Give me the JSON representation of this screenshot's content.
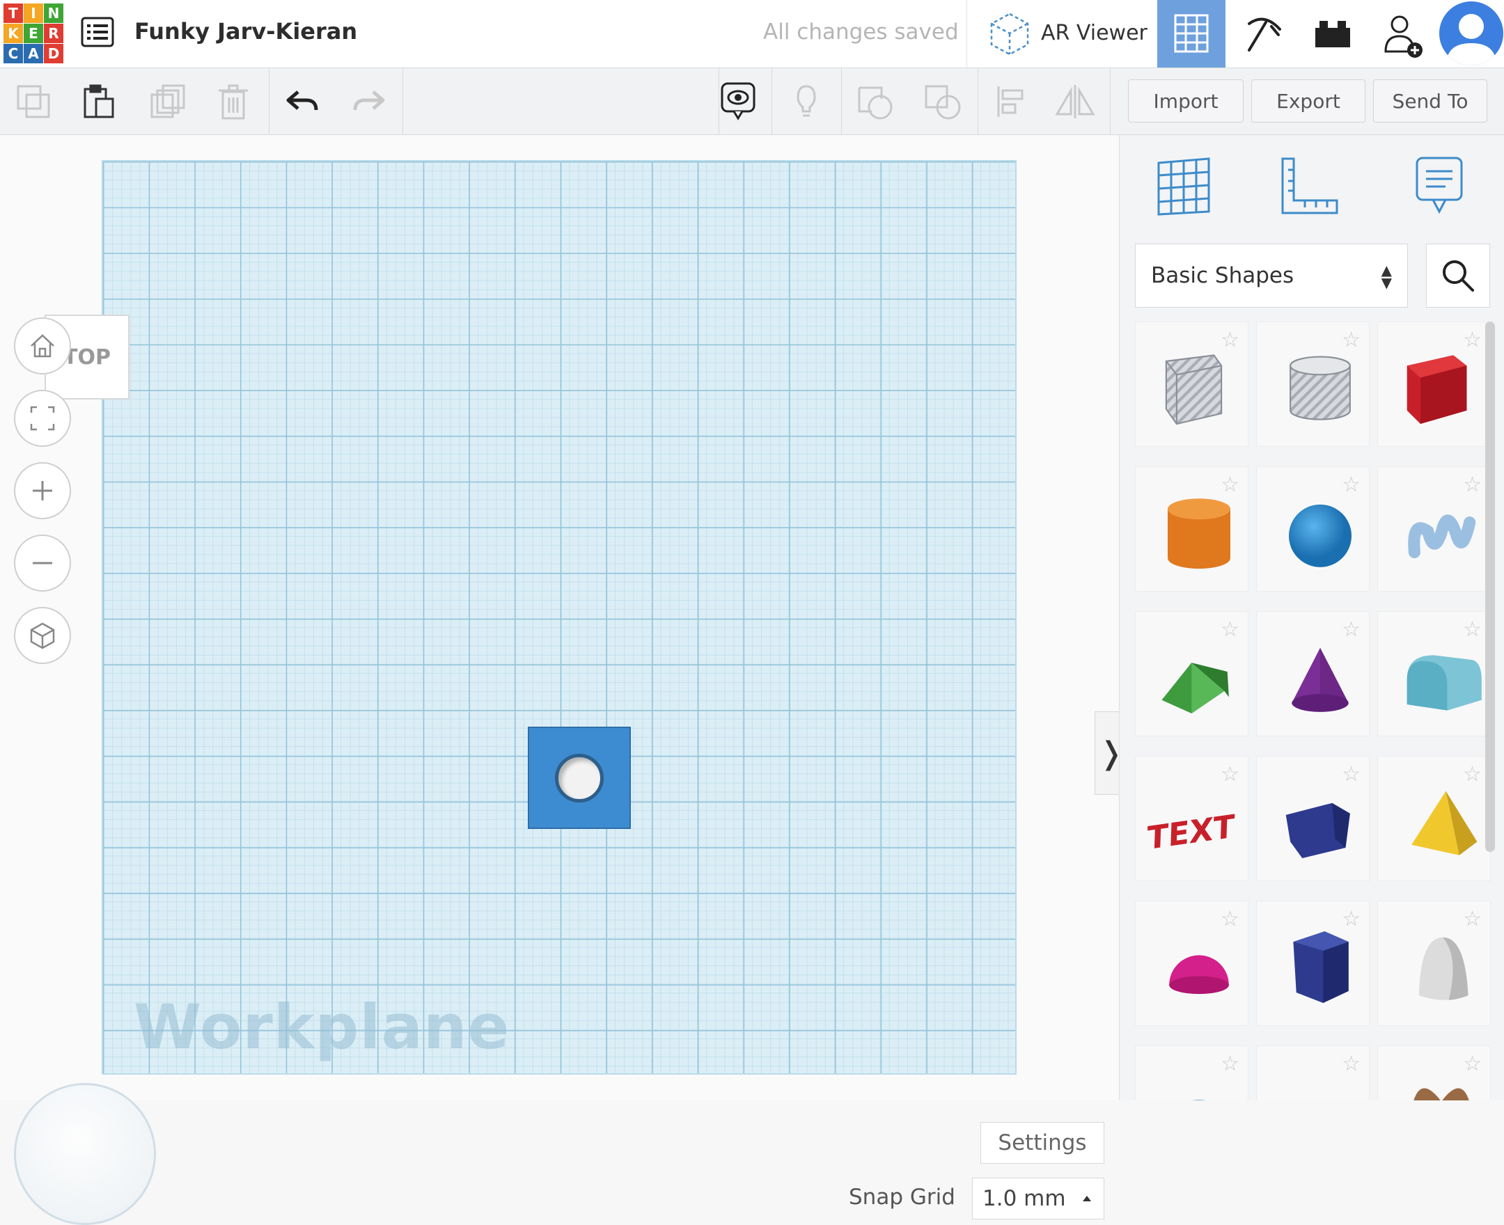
{
  "app": {
    "logo_letters": [
      "T",
      "I",
      "N",
      "K",
      "E",
      "R",
      "C",
      "A",
      "D"
    ],
    "project_title": "Funky Jarv-Kieran",
    "save_status": "All changes saved",
    "ar_viewer_label": "AR Viewer"
  },
  "toolbar": {
    "import_label": "Import",
    "export_label": "Export",
    "send_to_label": "Send To"
  },
  "canvas": {
    "view_cube_label": "TOP",
    "workplane_label": "Workplane",
    "settings_label": "Settings",
    "snap_grid_label": "Snap Grid",
    "snap_grid_value": "1.0 mm",
    "collapse_glyph": "❭"
  },
  "panel": {
    "library_selected": "Basic Shapes",
    "shapes": [
      {
        "name": "box-hole"
      },
      {
        "name": "cylinder-hole"
      },
      {
        "name": "box"
      },
      {
        "name": "cylinder"
      },
      {
        "name": "sphere"
      },
      {
        "name": "scribble"
      },
      {
        "name": "roof"
      },
      {
        "name": "cone"
      },
      {
        "name": "round-roof"
      },
      {
        "name": "text"
      },
      {
        "name": "polygon"
      },
      {
        "name": "pyramid"
      },
      {
        "name": "half-sphere"
      },
      {
        "name": "prism"
      },
      {
        "name": "paraboloid"
      },
      {
        "name": "torus"
      },
      {
        "name": "tube"
      },
      {
        "name": "heart"
      }
    ]
  },
  "colors": {
    "accent": "#6ea0de",
    "shape_blue": "#3d8bd0",
    "logo": [
      "#e03c31",
      "#f5a623",
      "#3fa535",
      "#f5a623",
      "#3fa535",
      "#e03c31",
      "#2b6cb0",
      "#2b6cb0",
      "#e03c31"
    ]
  }
}
